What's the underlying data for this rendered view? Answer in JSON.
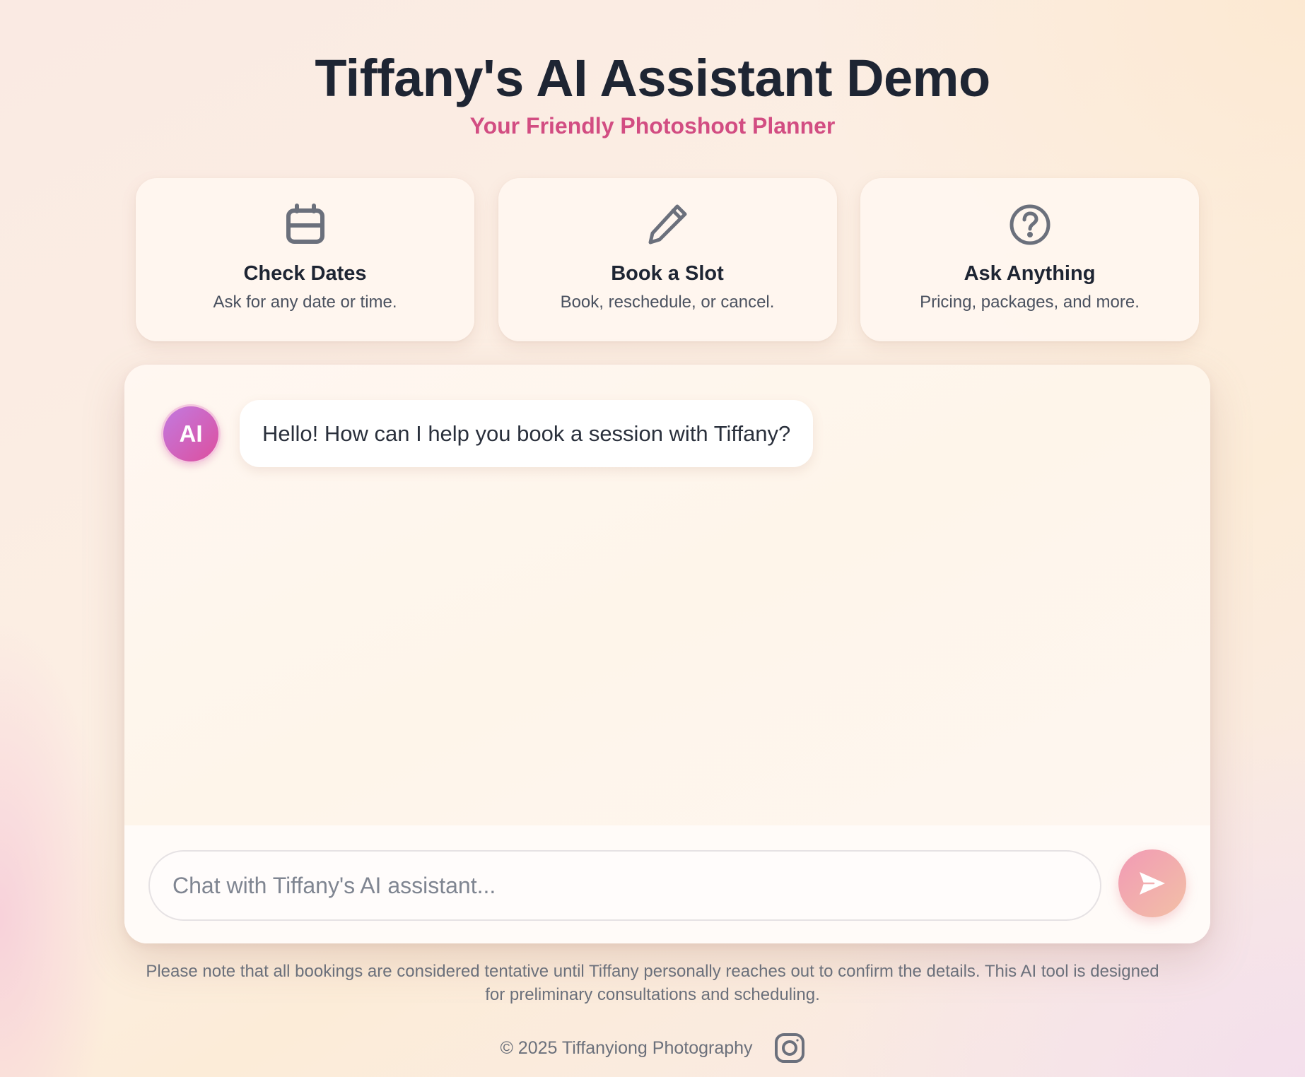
{
  "header": {
    "title": "Tiffany's AI Assistant Demo",
    "subtitle": "Your Friendly Photoshoot Planner"
  },
  "features": [
    {
      "icon": "calendar-icon",
      "title": "Check Dates",
      "description": "Ask for any date or time."
    },
    {
      "icon": "pencil-icon",
      "title": "Book a Slot",
      "description": "Book, reschedule, or cancel."
    },
    {
      "icon": "question-circle-icon",
      "title": "Ask Anything",
      "description": "Pricing, packages, and more."
    }
  ],
  "chat": {
    "messages": [
      {
        "sender": "assistant",
        "avatar_label": "AI",
        "text": "Hello! How can I help you book a session with Tiffany?"
      }
    ],
    "input": {
      "value": "",
      "placeholder": "Chat with Tiffany's AI assistant..."
    },
    "send_icon": "send-icon"
  },
  "disclaimer": "Please note that all bookings are considered tentative until Tiffany personally reaches out to confirm the details. This AI tool is designed for preliminary consultations and scheduling.",
  "footer": {
    "copyright": "© 2025 Tiffanyiong Photography",
    "social_icon": "instagram-icon"
  },
  "colors": {
    "title": "#1e2533",
    "subtitle_accent": "#d24d82",
    "avatar_gradient": [
      "#c27ae0",
      "#dd4f9e"
    ],
    "send_gradient": [
      "#f19ab5",
      "#f3c0a6"
    ],
    "icon_gray": "#6b707c"
  }
}
